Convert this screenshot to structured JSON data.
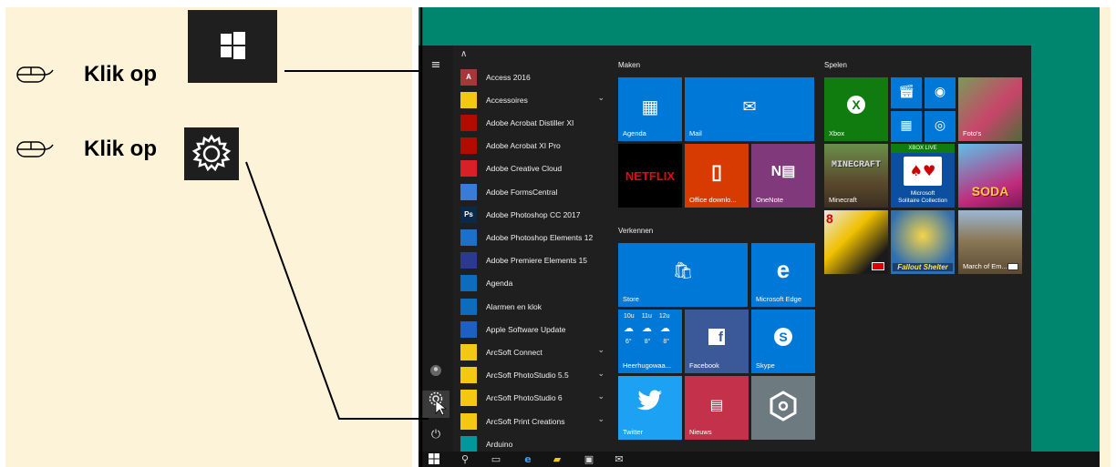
{
  "instructions": {
    "step1": {
      "label": "Klik op",
      "target": "start-button"
    },
    "step2": {
      "label": "Klik op",
      "target": "settings-button"
    }
  },
  "start_menu": {
    "collapse_glyph": "∧",
    "apps": [
      {
        "name": "Access 2016",
        "icon_text": "A",
        "color": "#a4373a",
        "has_chevron": false
      },
      {
        "name": "Accessoires",
        "icon_text": "",
        "color": "#f2c811",
        "has_chevron": true
      },
      {
        "name": "Adobe Acrobat Distiller XI",
        "icon_text": "",
        "color": "#b30b00",
        "has_chevron": false
      },
      {
        "name": "Adobe Acrobat XI Pro",
        "icon_text": "",
        "color": "#b30b00",
        "has_chevron": false
      },
      {
        "name": "Adobe Creative Cloud",
        "icon_text": "",
        "color": "#da1f26",
        "has_chevron": false
      },
      {
        "name": "Adobe FormsCentral",
        "icon_text": "",
        "color": "#3a7bd5",
        "has_chevron": false
      },
      {
        "name": "Adobe Photoshop CC 2017",
        "icon_text": "Ps",
        "color": "#0b2a4a",
        "has_chevron": false
      },
      {
        "name": "Adobe Photoshop Elements 12",
        "icon_text": "",
        "color": "#1e6fc8",
        "has_chevron": false
      },
      {
        "name": "Adobe Premiere Elements 15",
        "icon_text": "",
        "color": "#2b3a8f",
        "has_chevron": false
      },
      {
        "name": "Agenda",
        "icon_text": "",
        "color": "#0f6cbd",
        "has_chevron": false
      },
      {
        "name": "Alarmen en klok",
        "icon_text": "",
        "color": "#0f6cbd",
        "has_chevron": false
      },
      {
        "name": "Apple Software Update",
        "icon_text": "",
        "color": "#1f5fbf",
        "has_chevron": false
      },
      {
        "name": "ArcSoft Connect",
        "icon_text": "",
        "color": "#f2c811",
        "has_chevron": true
      },
      {
        "name": "ArcSoft PhotoStudio 5.5",
        "icon_text": "",
        "color": "#f2c811",
        "has_chevron": true
      },
      {
        "name": "ArcSoft PhotoStudio 6",
        "icon_text": "",
        "color": "#f2c811",
        "has_chevron": true
      },
      {
        "name": "ArcSoft Print Creations",
        "icon_text": "",
        "color": "#f2c811",
        "has_chevron": true
      },
      {
        "name": "Arduino",
        "icon_text": "",
        "color": "#00979d",
        "has_chevron": false
      }
    ],
    "groups": {
      "maken": "Maken",
      "verkennen": "Verkennen",
      "spelen": "Spelen"
    },
    "tiles": {
      "agenda": "Agenda",
      "mail": "Mail",
      "netflix": "NETFLIX",
      "office": "Office downlo...",
      "onenote": "OneNote",
      "store": "Store",
      "edge": "Microsoft Edge",
      "weather_hours": [
        "10u",
        "11u",
        "12u"
      ],
      "weather_temps": [
        "6°",
        "8°",
        "8°"
      ],
      "weather_place": "Heerhugowaa...",
      "facebook": "Facebook",
      "skype": "Skype",
      "twitter": "Twitter",
      "nieuws": "Nieuws",
      "xbox": "Xbox",
      "fotos": "Foto's",
      "minecraft": "Minecraft",
      "minecraft_art": "MINECRAFT",
      "solitaire_badge": "XBOX LIVE",
      "solitaire_1": "Microsoft",
      "solitaire_2": "Solitaire Collection",
      "soda": "SODA",
      "fallout": "Fallout Shelter",
      "march": "March of Em...",
      "asphalt_badge": "8"
    }
  },
  "colors": {
    "tile_blue": "#0078d7",
    "office_orange": "#d83b01",
    "onenote_purple": "#80397b",
    "xbox_green": "#107c10",
    "teal": "#00866f",
    "panel": "#fdf3d9"
  }
}
